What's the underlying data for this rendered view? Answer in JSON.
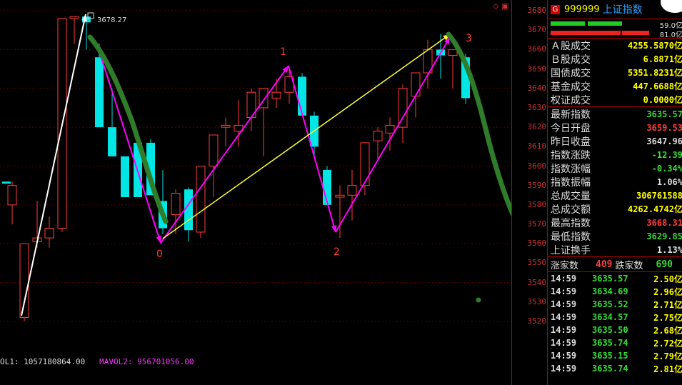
{
  "chart": {
    "high_label": "3678.27",
    "wave_labels": {
      "p0": "0",
      "p1": "1",
      "p2": "2",
      "p3": "3"
    },
    "colors": {
      "up": "#ff3c3c",
      "down": "#00e5e5",
      "wave": "#2f7d2a",
      "magenta": "#ff00ff",
      "yellow": "#ffff33",
      "white": "#ffffff"
    },
    "y_min": 3515,
    "y_max": 3685,
    "candles": [
      [
        9,
        3592,
        3592,
        3591,
        3591
      ],
      [
        17,
        3580,
        3592,
        3570,
        3590
      ],
      [
        34,
        3522,
        3560,
        3520,
        3560
      ],
      [
        52,
        3561,
        3582,
        3558,
        3563
      ],
      [
        69,
        3563,
        3574,
        3558,
        3568
      ],
      [
        87,
        3568,
        3662,
        3566,
        3676
      ],
      [
        104,
        3676,
        3676,
        3663,
        3677
      ],
      [
        121,
        3677,
        3670,
        3660,
        3674
      ],
      [
        139,
        3656,
        3663,
        3620,
        3620
      ],
      [
        157,
        3620,
        3640,
        3605,
        3605
      ],
      [
        175,
        3605,
        3605,
        3584,
        3584
      ],
      [
        193,
        3612,
        3614,
        3584,
        3584
      ],
      [
        211,
        3612,
        3614,
        3585,
        3585
      ],
      [
        228,
        3582,
        3598,
        3565,
        3568
      ],
      [
        246,
        3575,
        3588,
        3565,
        3586
      ],
      [
        264,
        3588,
        3589,
        3561,
        3567
      ],
      [
        281,
        3566,
        3598,
        3563,
        3600
      ],
      [
        299,
        3600,
        3612,
        3584,
        3616
      ],
      [
        316,
        3620,
        3625,
        3610,
        3621
      ],
      [
        334,
        3618,
        3634,
        3610,
        3621
      ],
      [
        352,
        3625,
        3640,
        3618,
        3638
      ],
      [
        369,
        3630,
        3640,
        3605,
        3640
      ],
      [
        387,
        3635,
        3645,
        3630,
        3638
      ],
      [
        405,
        3638,
        3650,
        3632,
        3646
      ],
      [
        423,
        3646,
        3648,
        3626,
        3626
      ],
      [
        440,
        3626,
        3628,
        3605,
        3610
      ],
      [
        458,
        3598,
        3600,
        3580,
        3580
      ],
      [
        476,
        3584,
        3590,
        3563,
        3585
      ],
      [
        493,
        3585,
        3598,
        3572,
        3590
      ],
      [
        511,
        3590,
        3612,
        3585,
        3612
      ],
      [
        529,
        3613,
        3620,
        3603,
        3618
      ],
      [
        546,
        3617,
        3625,
        3608,
        3621
      ],
      [
        564,
        3620,
        3642,
        3612,
        3640
      ],
      [
        582,
        3636,
        3646,
        3625,
        3648
      ],
      [
        599,
        3648,
        3665,
        3640,
        3660
      ],
      [
        617,
        3660,
        3668,
        3645,
        3657
      ],
      [
        634,
        3657,
        3660,
        3640,
        3660
      ],
      [
        652,
        3656,
        3658,
        3632,
        3635
      ]
    ],
    "vol_labels": {
      "mavol1": "OL1: 1057180864.00",
      "mavol2": "MAVOL2: 956701056.00"
    }
  },
  "axis": {
    "ticks": [
      "3680",
      "3670",
      "3660",
      "3650",
      "3640",
      "3630",
      "3620",
      "3610",
      "3600",
      "3590",
      "3580",
      "3570",
      "3560",
      "3550",
      "3540",
      "3530",
      "3520"
    ]
  },
  "panel": {
    "badge": "G",
    "code": "999999",
    "name": "上证指数",
    "bar_up_label": "59.0亿",
    "bar_down_label": "81.0亿",
    "turnover": [
      {
        "label": "Ａ股成交",
        "value": "4255.5870亿"
      },
      {
        "label": "Ｂ股成交",
        "value": "6.8871亿"
      },
      {
        "label": "国债成交",
        "value": "5351.8231亿"
      },
      {
        "label": "基金成交",
        "value": "447.6688亿"
      },
      {
        "label": "权证成交",
        "value": "0.0000亿"
      }
    ],
    "stats": [
      {
        "label": "最新指数",
        "value": "3635.57",
        "color": "gr"
      },
      {
        "label": "今日开盘",
        "value": "3659.53",
        "color": "r"
      },
      {
        "label": "昨日收盘",
        "value": "3647.96",
        "color": "w"
      },
      {
        "label": "指数涨跌",
        "value": "-12.39",
        "color": "gr"
      },
      {
        "label": "指数涨幅",
        "value": "-0.34%",
        "color": "gr"
      },
      {
        "label": "指数振幅",
        "value": "1.06%",
        "color": "w"
      },
      {
        "label": "总成交量",
        "value": "306761588",
        "color": "y"
      },
      {
        "label": "总成交额",
        "value": "4262.4742亿",
        "color": "y"
      },
      {
        "label": "最高指数",
        "value": "3668.31",
        "color": "r"
      },
      {
        "label": "最低指数",
        "value": "3629.85",
        "color": "gr"
      },
      {
        "label": "上证换手",
        "value": "1.13%",
        "color": "w"
      }
    ],
    "up_label": "涨家数",
    "up_count": "409",
    "down_label": "跌家数",
    "down_count": "690",
    "ticks": [
      {
        "t": "14:59",
        "p": "3635.57",
        "v": "2.50亿"
      },
      {
        "t": "14:59",
        "p": "3634.69",
        "v": "2.96亿"
      },
      {
        "t": "14:59",
        "p": "3635.52",
        "v": "2.71亿"
      },
      {
        "t": "14:59",
        "p": "3634.57",
        "v": "2.75亿"
      },
      {
        "t": "14:59",
        "p": "3635.50",
        "v": "2.68亿"
      },
      {
        "t": "14:59",
        "p": "3635.74",
        "v": "2.72亿"
      },
      {
        "t": "14:59",
        "p": "3635.15",
        "v": "2.79亿"
      },
      {
        "t": "14:59",
        "p": "3635.74",
        "v": "2.81亿"
      }
    ]
  }
}
